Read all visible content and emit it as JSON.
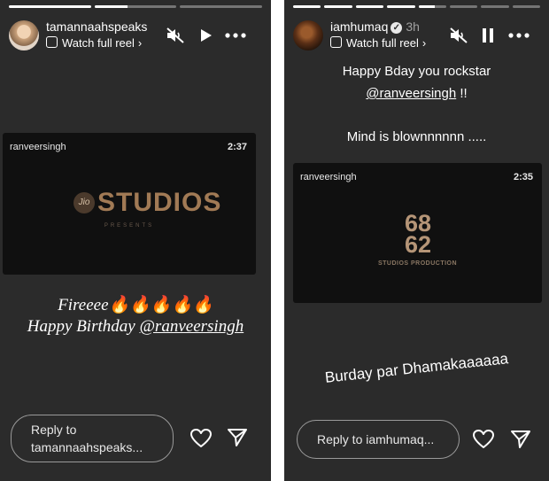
{
  "left_story": {
    "progress": [
      1.0,
      0.4,
      0.0
    ],
    "username": "tamannaahspeaks",
    "watch_reel": "Watch full reel",
    "reel": {
      "owner": "ranveersingh",
      "duration": "2:37",
      "brand_mark": "Jio",
      "brand": "STUDIOS",
      "brand_sub": "PRESENTS"
    },
    "caption_line1": "Fireeee🔥🔥🔥🔥🔥",
    "caption_line2_prefix": "Happy Birthday ",
    "caption_line2_mention": "@ranveersingh",
    "reply_placeholder": "Reply to tamannaahspeaks..."
  },
  "right_story": {
    "progress": [
      1.0,
      1.0,
      1.0,
      1.0,
      0.6,
      0.0,
      0.0,
      0.0
    ],
    "username": "iamhumaq",
    "verified_mark": "✓",
    "time": "3h",
    "watch_reel": "Watch full reel",
    "text_line1": "Happy Bday you rockstar",
    "text_mention": "@ranveersingh",
    "text_suffix": " !!",
    "text_line3": "Mind is blownnnnnn .....",
    "reel": {
      "owner": "ranveersingh",
      "duration": "2:35",
      "logo_top": "68",
      "logo_bottom": "62",
      "logo_caption": "STUDIOS PRODUCTION"
    },
    "bottom_text": "Burday par Dhamakaaaaaa",
    "reply_placeholder": "Reply to iamhumaq..."
  }
}
